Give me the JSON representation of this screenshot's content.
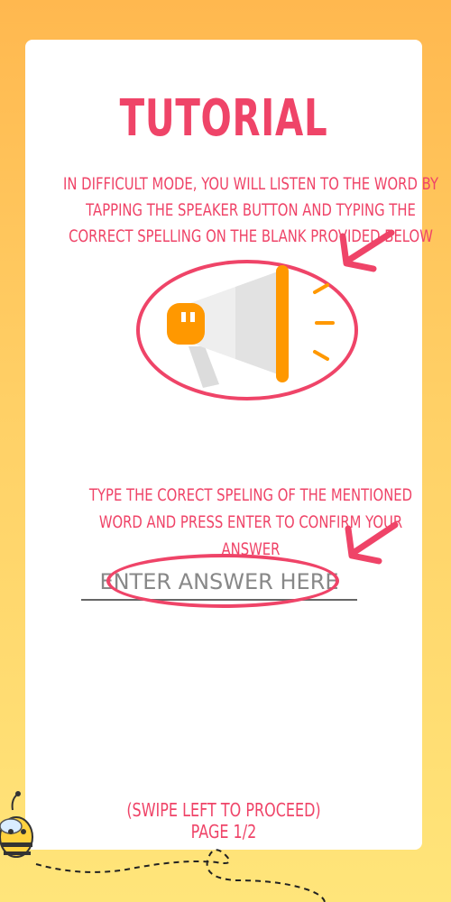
{
  "tutorial": {
    "title": "Tutorial",
    "instructions": "In difficult mode, you will listen to the word by tapping the speaker button and typing the correct spelling on the blank provided below",
    "prompt": "Type the corect speling of the mentioned word and press enter to confirm your answer",
    "answer_placeholder": "Enter answer here",
    "swipe_hint": "(Swipe left to proceed)",
    "page_indicator": "Page 1/2"
  },
  "icons": {
    "speaker": "megaphone-icon",
    "pointer": "arrow-icon",
    "mascot": "bee-icon"
  },
  "colors": {
    "accent": "#ef4468",
    "speaker_orange": "#ff9800",
    "bg_top": "#ffb84f",
    "bg_bottom": "#ffe57a"
  }
}
